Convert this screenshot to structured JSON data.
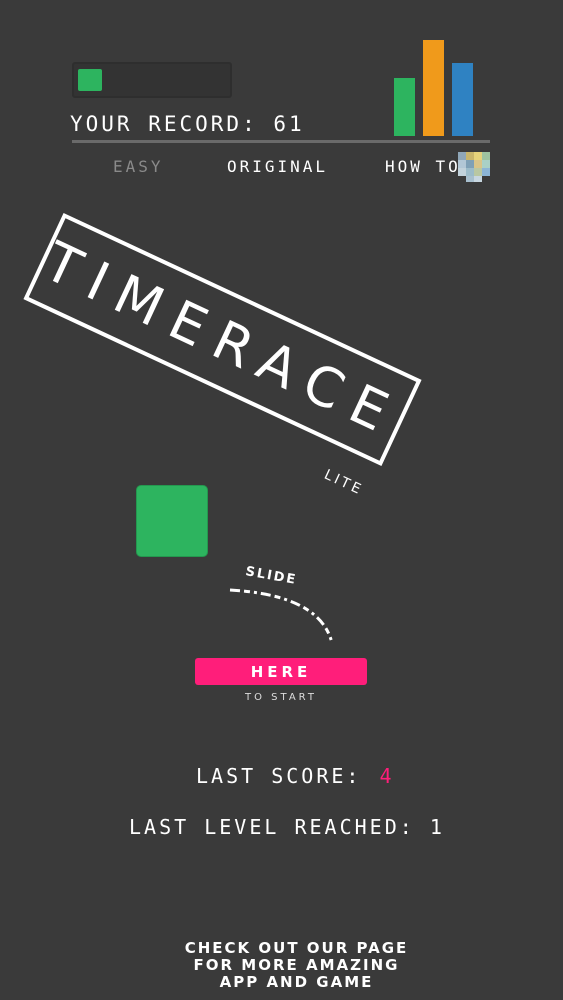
{
  "header": {
    "progress_fraction": 0.12,
    "record_label": "YOUR RECORD: 61"
  },
  "tabs": [
    {
      "label": "EASY",
      "active": false
    },
    {
      "label": "ORIGINAL",
      "active": true
    },
    {
      "label": "HOW TO",
      "active": false
    }
  ],
  "title": {
    "text": "TIMERACE",
    "edition": "LITE"
  },
  "slide_hint": {
    "label": "SLIDE",
    "button_label": "HERE",
    "caption": "TO START"
  },
  "stats": {
    "last_score_label": "LAST SCORE:",
    "last_score_value": "4",
    "last_level_label": "LAST LEVEL REACHED: 1"
  },
  "footer": {
    "line1": "CHECK OUT OUR PAGE",
    "line2": "FOR MORE AMAZING",
    "line3": "APP AND GAME"
  },
  "colors": {
    "background": "#3a3a3a",
    "green": "#2db45f",
    "orange": "#f09a1b",
    "blue": "#2f82c2",
    "accent_pink": "#ff1e7a"
  },
  "icons": {
    "leaderboard": "bar-chart-icon",
    "how_to": "pixel-question-icon"
  }
}
